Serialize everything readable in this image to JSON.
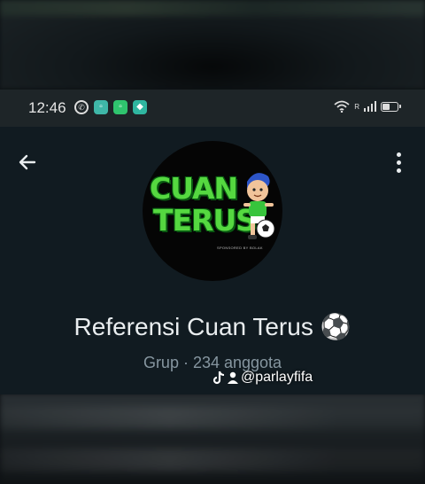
{
  "status_bar": {
    "time": "12:46",
    "network_label": "R",
    "battery_level": 0.55,
    "notification_icons": [
      "whatsapp-icon",
      "app-badge-icon",
      "app-badge-icon",
      "shield-badge-icon"
    ],
    "badge_colors": [
      "#3fb7a8",
      "#2fc46e",
      "#2fb6a0"
    ]
  },
  "header": {
    "back_icon": "arrow-left-icon",
    "menu_icon": "more-vertical-icon"
  },
  "group": {
    "avatar_text_line1": "CUAN",
    "avatar_text_line2": "TERUS",
    "avatar_sponsor": "SPONSORED BY BOLAK",
    "name": "Referensi Cuan Terus ⚽",
    "subtitle": "Grup · 234 anggota"
  },
  "watermark": {
    "platform_icon": "tiktok-icon",
    "handle": "@parlayfifa"
  },
  "colors": {
    "panel_bg": "#111b21",
    "status_bar_bg": "#1e2528",
    "subtitle": "#8696a0",
    "logo_green": "#55d840"
  }
}
